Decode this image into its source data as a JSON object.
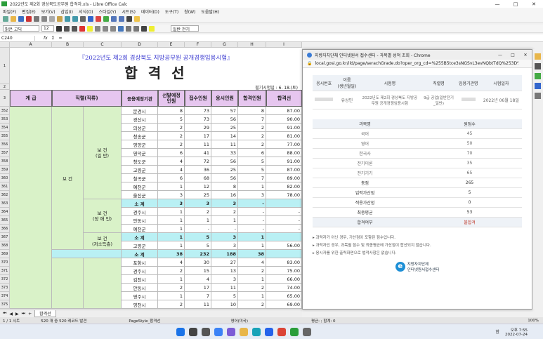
{
  "window": {
    "title": "2022년도 제2회 경상북도공무원 합격자.xls - Libre Office Calc",
    "controls": [
      "—",
      "□",
      "✕"
    ]
  },
  "menu": [
    "파일(F)",
    "편집(E)",
    "보기(V)",
    "삽입(I)",
    "서식(O)",
    "스타일(Y)",
    "시트(S)",
    "데이터(D)",
    "도구(T)",
    "창(W)",
    "도움말(H)"
  ],
  "font_bar": {
    "font_name": "맑은 고딕",
    "font_size": "12",
    "style": "일반 전기"
  },
  "formula_bar": {
    "cell_ref": "C240",
    "fx": "fx",
    "sum": "Σ",
    "eq": "="
  },
  "columns": [
    "A",
    "B",
    "C",
    "D",
    "E",
    "F",
    "G",
    "H",
    "I"
  ],
  "sheet": {
    "title_line": "『2022년도 제2회 경상북도 지방공무원 공개경쟁임용시험』",
    "title_big": "합  격  선",
    "date_note": "필기시험일 : 6. 18.(토)",
    "headers": {
      "grade": "계 급",
      "job": "직렬(직류)",
      "area": "응용예정기관",
      "quota": "선발예정인원",
      "applicants": "접수인원",
      "examinees": "응시인원",
      "passers": "합격인원",
      "cutoff": "합격선"
    },
    "group_main": "보    건",
    "group_a": "보   건\n(일   반)",
    "group_b": "보   건\n(장 애 인)",
    "group_c": "보   건\n(저소득층)",
    "row_numbers": [
      "1",
      "2",
      "3",
      "352",
      "353",
      "354",
      "355",
      "356",
      "357",
      "358",
      "359",
      "360",
      "361",
      "362",
      "363",
      "364",
      "365",
      "366",
      "367",
      "368",
      "369",
      "370",
      "371",
      "372",
      "373",
      "374",
      "375"
    ],
    "rows": [
      [
        "문경시",
        "8",
        "73",
        "57",
        "8",
        "87.00"
      ],
      [
        "경산시",
        "5",
        "73",
        "56",
        "7",
        "90.00"
      ],
      [
        "의성군",
        "2",
        "29",
        "25",
        "2",
        "91.00"
      ],
      [
        "청송군",
        "2",
        "17",
        "14",
        "2",
        "81.00"
      ],
      [
        "영양군",
        "2",
        "11",
        "11",
        "2",
        "77.00"
      ],
      [
        "영덕군",
        "6",
        "41",
        "33",
        "6",
        "88.00"
      ],
      [
        "청도군",
        "4",
        "72",
        "56",
        "5",
        "91.00"
      ],
      [
        "고령군",
        "4",
        "36",
        "25",
        "5",
        "87.00"
      ],
      [
        "칠곡군",
        "6",
        "68",
        "56",
        "7",
        "89.00"
      ],
      [
        "예천군",
        "1",
        "12",
        "8",
        "1",
        "82.00"
      ],
      [
        "울진군",
        "3",
        "25",
        "16",
        "3",
        "78.00"
      ],
      [
        "소  계",
        "3",
        "3",
        "3",
        "-",
        ""
      ],
      [
        "경주시",
        "1",
        "2",
        "2",
        "-",
        "-"
      ],
      [
        "안동시",
        "1",
        "1",
        "1",
        "-",
        "-"
      ],
      [
        "예천군",
        "1",
        "-",
        "-",
        "-",
        "-"
      ],
      [
        "소  계",
        "1",
        "5",
        "3",
        "1",
        ""
      ],
      [
        "고령군",
        "1",
        "5",
        "3",
        "1",
        "56.00"
      ],
      [
        "소  계",
        "38",
        "232",
        "188",
        "38",
        ""
      ],
      [
        "포항시",
        "4",
        "30",
        "27",
        "4",
        "83.00"
      ],
      [
        "경주시",
        "2",
        "15",
        "13",
        "2",
        "75.00"
      ],
      [
        "김천시",
        "1",
        "4",
        "3",
        "1",
        "66.00"
      ],
      [
        "안동시",
        "2",
        "17",
        "11",
        "2",
        "74.00"
      ],
      [
        "영주시",
        "1",
        "7",
        "5",
        "1",
        "65.00"
      ],
      [
        "영천시",
        "2",
        "11",
        "10",
        "2",
        "69.00"
      ]
    ]
  },
  "tabs": {
    "first": "합격선",
    "add": "+"
  },
  "status": {
    "pos": "1 / 1 시트",
    "selection": "520 개 중 520 레코드 발견",
    "pagestyle": "PageStyle_합격선",
    "lang": "영어(미국)",
    "sum": "평균: ; 합계: 0",
    "zoom": "100%"
  },
  "browser": {
    "title": "지방자치단체 인터넷원서 접수센터 - 과목별 성적 조회 - Chrome",
    "url": "local.gosi.go.kr/ild/page/serachGrade.do?oper_org_cd=%255B5tce3sNGSvL3evNQbtTdQ%253D%253D...",
    "table_headers": [
      "응시번호",
      "이름\n(생년월일)",
      "시험명",
      "직렬명",
      "임용기관명",
      "시험일자"
    ],
    "table_row": [
      "",
      "유상민\n",
      "2022년도 제2회 경상북도 지방공\n무원 공개경쟁임용시험",
      "9급 공업(일반전기\n_일반)",
      "",
      "2022년 06월 18일"
    ],
    "score_headers": [
      "과목명",
      "원점수"
    ],
    "scores": [
      [
        "국어",
        "45"
      ],
      [
        "영어",
        "50"
      ],
      [
        "한국사",
        "70"
      ],
      [
        "전기이론",
        "35"
      ],
      [
        "전기기기",
        "65"
      ],
      [
        "총점",
        "265"
      ],
      [
        "입력가산점",
        "5"
      ],
      [
        "적용가산점",
        "0"
      ],
      [
        "최종평균",
        "53"
      ],
      [
        "합격여부",
        "불합격"
      ]
    ],
    "notes": [
      "과락자가 아닌 경우, 가산점이 포함된 점수입니다.",
      "과락자인 경우, 과목별 점수 및 최종평균에 가산점이 합산되지 않습니다.",
      "응시자를 위한 출력화면으로 법적사항은 없습니다."
    ],
    "logo_line1": "지방자치단체",
    "logo_line2": "인터넷원서접수센터"
  },
  "taskbar": {
    "time": "오후 7:55",
    "date": "2022-07-24",
    "lang": "한"
  },
  "colors": {
    "header_purple": "#e6c6ef",
    "green_fill": "#d9f2c8",
    "cyan_fill": "#b9f0f4",
    "title_blue": "#3a3ad0"
  }
}
